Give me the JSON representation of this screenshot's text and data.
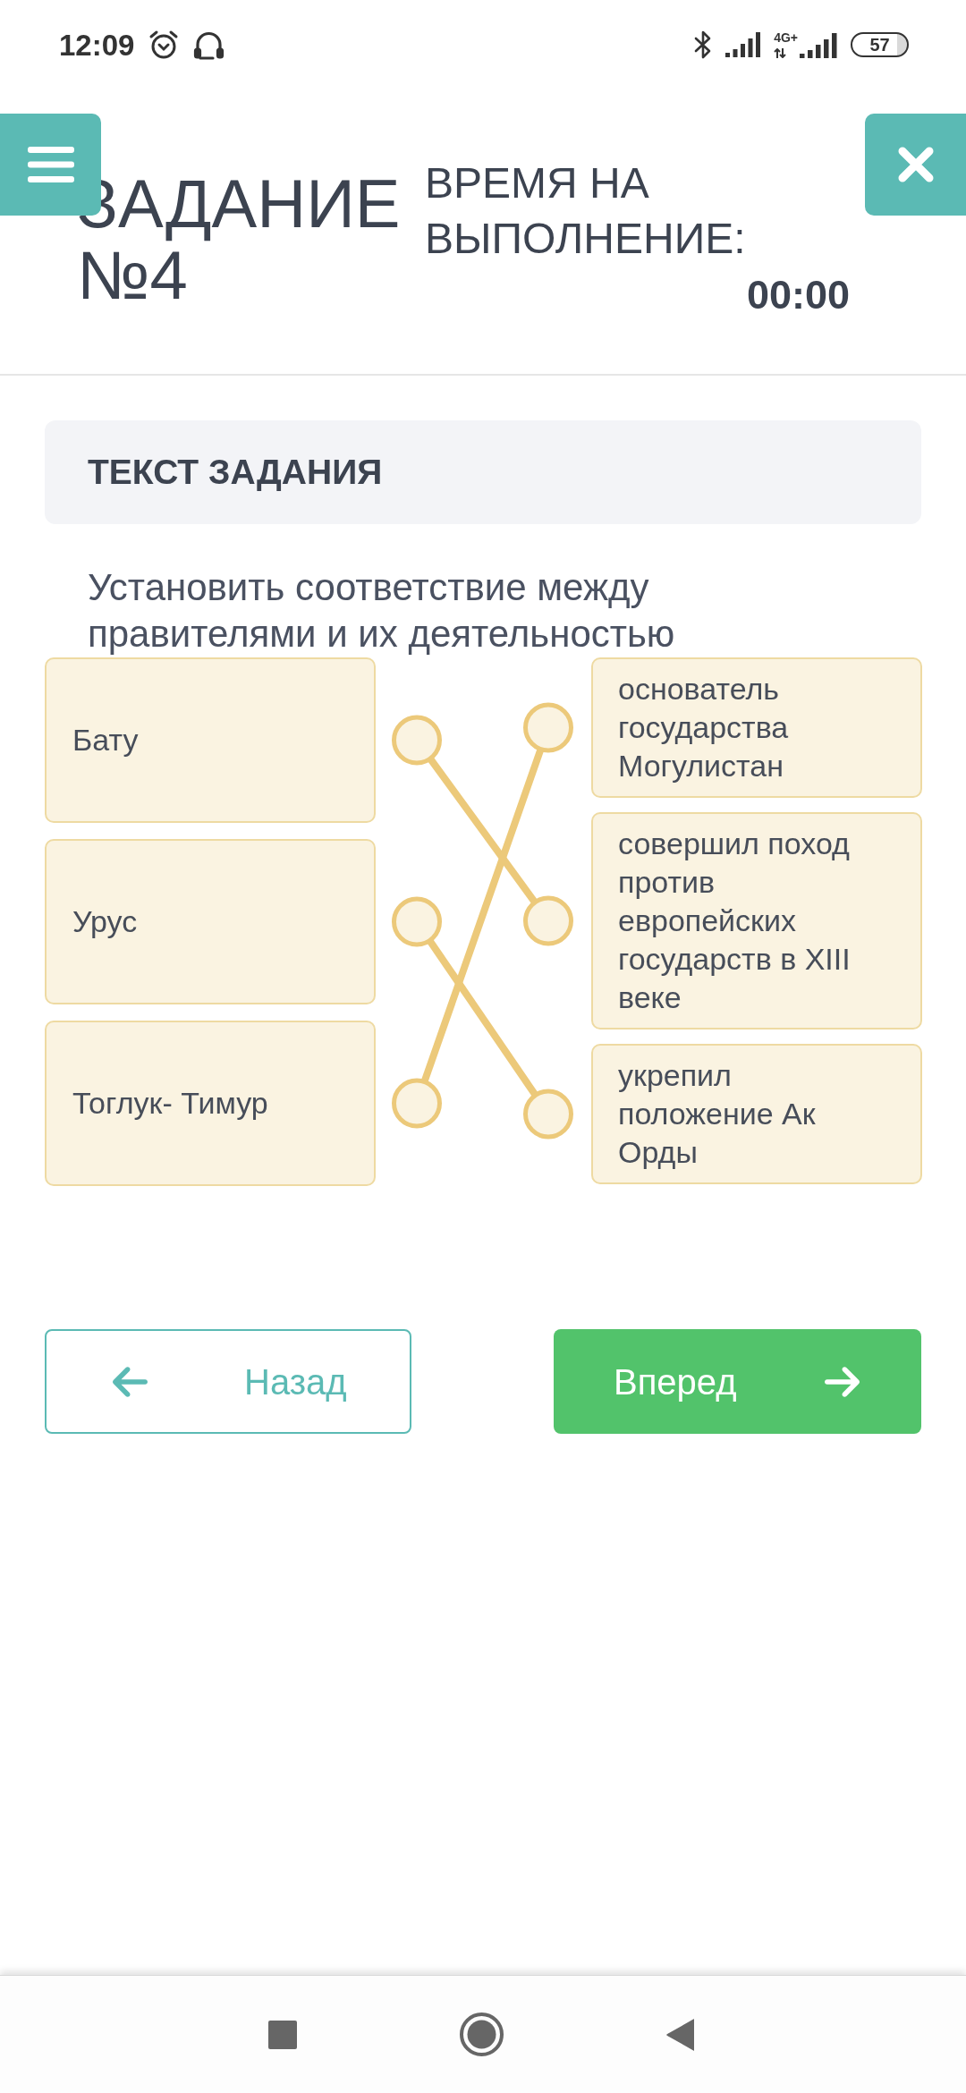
{
  "status_bar": {
    "time": "12:09",
    "network": "4G+",
    "battery": "57"
  },
  "header": {
    "title": "ЗАДАНИЕ №4",
    "timer_label": "ВРЕМЯ НА ВЫПОЛНЕНИЕ:",
    "timer_value": "00:00"
  },
  "task": {
    "heading": "ТЕКСТ ЗАДАНИЯ",
    "instruction": "Установить соответствие между правителями и их деятельностью"
  },
  "matching": {
    "left": [
      {
        "text": "Бату",
        "links": [
          false,
          true,
          false
        ]
      },
      {
        "text": "Урус",
        "links": [
          false,
          false,
          true
        ]
      },
      {
        "text": "Тоглук- Тимур",
        "links": [
          true,
          false,
          false
        ]
      }
    ],
    "right": [
      {
        "text": "основатель государства Могулистан"
      },
      {
        "text": "совершил поход против европейских государств в XIII веке"
      },
      {
        "text": "укрепил положение Ак Орды"
      }
    ]
  },
  "navigation": [
    {
      "label": "Назад",
      "kind": "back"
    },
    {
      "label": "Вперед",
      "kind": "forward"
    }
  ]
}
